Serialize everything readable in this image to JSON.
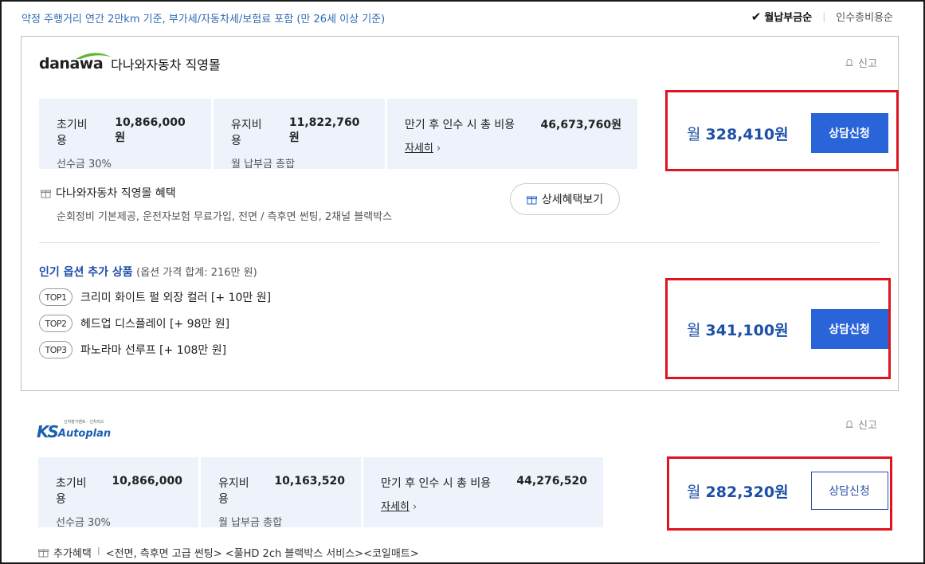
{
  "notice": "약정 주행거리 연간 2만km 기준, 부가세/자동차세/보험료 포함 (만 26세 이상 기준)",
  "sort": {
    "active": "월납부금순",
    "inactive": "인수총비용순"
  },
  "report_label": "신고",
  "offers": [
    {
      "logo_text": "danawa",
      "shop_name": "다나와자동차 직영몰",
      "costs": [
        {
          "label": "초기비용",
          "value": "10,866,000원",
          "sub": "선수금 30%"
        },
        {
          "label": "유지비용",
          "value": "11,822,760원",
          "sub": "월 납부금 총합"
        },
        {
          "label": "만기 후 인수 시 총 비용",
          "value": "46,673,760원",
          "sub": "자세히",
          "sub_arrow": "›"
        }
      ],
      "benefit_title": "다나와자동차 직영몰 혜택",
      "benefit_desc": "순회정비 기본제공, 운전자보험 무료가입, 전면 / 측후면 썬팅, 2채널 블랙박스",
      "benefit_button": "상세혜택보기",
      "monthly_prefix": "월",
      "monthly_price": "328,410원",
      "consult_label": "상담신청",
      "options_title": "인기 옵션 추가 상품",
      "options_sub": "(옵션 가격 합계: 216만 원)",
      "options": [
        {
          "badge": "TOP1",
          "text": "크리미 화이트 펄 외장 컬러 [+ 10만 원]"
        },
        {
          "badge": "TOP2",
          "text": "헤드업 디스플레이 [+ 98만 원]"
        },
        {
          "badge": "TOP3",
          "text": "파노라마 선루프 [+ 108만 원]"
        }
      ],
      "options_monthly_price": "341,100원"
    },
    {
      "logo_text": "KS",
      "logo_sub": "Autoplan",
      "logo_tiny": "신차장기렌트 · 신차리스",
      "costs": [
        {
          "label": "초기비용",
          "value": "10,866,000",
          "sub": "선수금 30%"
        },
        {
          "label": "유지비용",
          "value": "10,163,520",
          "sub": "월 납부금 총합"
        },
        {
          "label": "만기 후 인수 시 총 비용",
          "value": "44,276,520",
          "sub": "자세히",
          "sub_arrow": "›"
        }
      ],
      "monthly_prefix": "월",
      "monthly_price": "282,320원",
      "consult_label": "상담신청",
      "extra_label": "추가혜택",
      "extra_text": "<전면, 측후면 고급 썬팅> <풀HD 2ch 블랙박스 서비스><코일매트>"
    }
  ],
  "colors": {
    "accent": "#2a64d9",
    "price": "#1d4fa8",
    "highlight_border": "#e0141e",
    "cost_bg": "#eef2fb",
    "notice": "#2f6ab4"
  }
}
